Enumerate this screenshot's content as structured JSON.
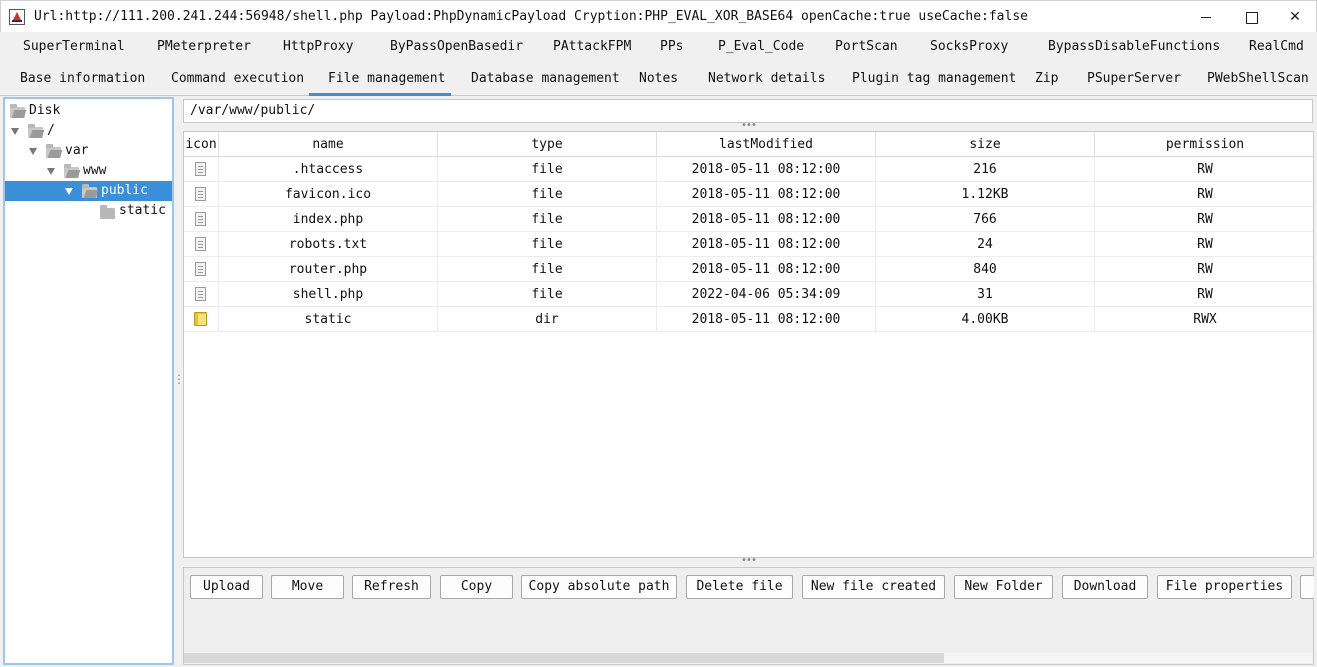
{
  "window": {
    "title": "Url:http://111.200.241.244:56948/shell.php Payload:PhpDynamicPayload Cryption:PHP_EVAL_XOR_BASE64 openCache:true useCache:false",
    "minimize_label": "",
    "maximize_label": "",
    "close_label": "✕"
  },
  "tabs_row1": [
    "SuperTerminal",
    "PMeterpreter",
    "HttpProxy",
    "ByPassOpenBasedir",
    "PAttackFPM",
    "PPs",
    "P_Eval_Code",
    "PortScan",
    "SocksProxy",
    "BypassDisableFunctions",
    "RealCmd"
  ],
  "tabs_row2": [
    "Base information",
    "Command execution",
    "File management",
    "Database management",
    "Notes",
    "Network details",
    "Plugin tag management",
    "Zip",
    "PSuperServer",
    "PWebShellScan"
  ],
  "selected_tab": "File management",
  "tree": [
    {
      "label": "Disk",
      "level": 0,
      "expanded": false,
      "selected": false
    },
    {
      "label": "/",
      "level": 1,
      "expanded": true,
      "selected": false
    },
    {
      "label": "var",
      "level": 2,
      "expanded": true,
      "selected": false
    },
    {
      "label": "www",
      "level": 3,
      "expanded": true,
      "selected": false
    },
    {
      "label": "public",
      "level": 4,
      "expanded": true,
      "selected": true
    },
    {
      "label": "static",
      "level": 5,
      "expanded": false,
      "selected": false
    }
  ],
  "path": "/var/www/public/",
  "table": {
    "columns": [
      "icon",
      "name",
      "type",
      "lastModified",
      "size",
      "permission"
    ],
    "rows": [
      {
        "icon": "file-icon",
        "name": ".htaccess",
        "type": "file",
        "lastModified": "2018-05-11 08:12:00",
        "size": "216",
        "permission": "RW"
      },
      {
        "icon": "file-icon",
        "name": "favicon.ico",
        "type": "file",
        "lastModified": "2018-05-11 08:12:00",
        "size": "1.12KB",
        "permission": "RW"
      },
      {
        "icon": "file-icon",
        "name": "index.php",
        "type": "file",
        "lastModified": "2018-05-11 08:12:00",
        "size": "766",
        "permission": "RW"
      },
      {
        "icon": "file-icon",
        "name": "robots.txt",
        "type": "file",
        "lastModified": "2018-05-11 08:12:00",
        "size": "24",
        "permission": "RW"
      },
      {
        "icon": "file-icon",
        "name": "router.php",
        "type": "file",
        "lastModified": "2018-05-11 08:12:00",
        "size": "840",
        "permission": "RW"
      },
      {
        "icon": "file-icon",
        "name": "shell.php",
        "type": "file",
        "lastModified": "2022-04-06 05:34:09",
        "size": "31",
        "permission": "RW"
      },
      {
        "icon": "folder-icon",
        "name": "static",
        "type": "dir",
        "lastModified": "2018-05-11 08:12:00",
        "size": "4.00KB",
        "permission": "RWX"
      }
    ]
  },
  "buttons": [
    "Upload",
    "Move",
    "Refresh",
    "Copy",
    "Copy absolute path",
    "Delete file",
    "New file created",
    "New Folder",
    "Download",
    "File properties",
    ""
  ],
  "colors": {
    "accent": "#3a8fd8",
    "tree_border": "#9ec6ec",
    "folder_yellow": "#e8c232"
  }
}
